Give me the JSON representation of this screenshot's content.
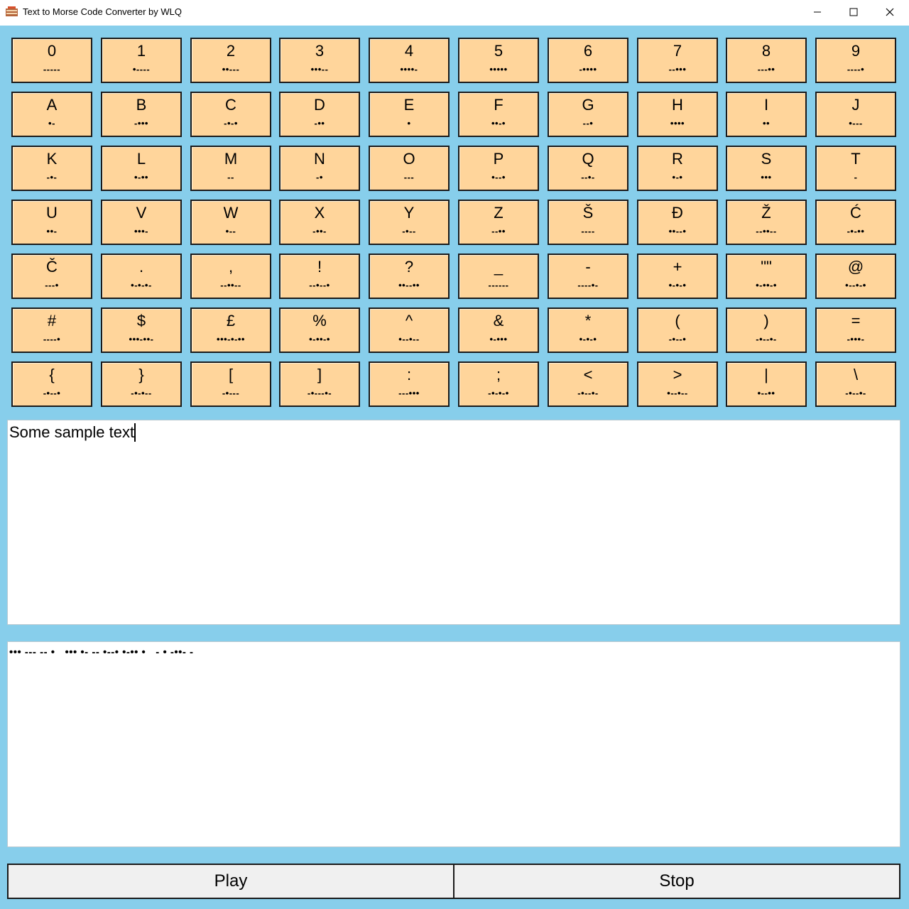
{
  "window": {
    "title": "Text to Morse Code Converter by WLQ"
  },
  "keys": [
    [
      {
        "char": "0",
        "morse": "-----"
      },
      {
        "char": "1",
        "morse": "•----"
      },
      {
        "char": "2",
        "morse": "••---"
      },
      {
        "char": "3",
        "morse": "•••--"
      },
      {
        "char": "4",
        "morse": "••••-"
      },
      {
        "char": "5",
        "morse": "•••••"
      },
      {
        "char": "6",
        "morse": "-••••"
      },
      {
        "char": "7",
        "morse": "--•••"
      },
      {
        "char": "8",
        "morse": "---••"
      },
      {
        "char": "9",
        "morse": "----•"
      }
    ],
    [
      {
        "char": "A",
        "morse": "•-"
      },
      {
        "char": "B",
        "morse": "-•••"
      },
      {
        "char": "C",
        "morse": "-•-•"
      },
      {
        "char": "D",
        "morse": "-••"
      },
      {
        "char": "E",
        "morse": "•"
      },
      {
        "char": "F",
        "morse": "••-•"
      },
      {
        "char": "G",
        "morse": "--•"
      },
      {
        "char": "H",
        "morse": "••••"
      },
      {
        "char": "I",
        "morse": "••"
      },
      {
        "char": "J",
        "morse": "•---"
      }
    ],
    [
      {
        "char": "K",
        "morse": "-•-"
      },
      {
        "char": "L",
        "morse": "•-••"
      },
      {
        "char": "M",
        "morse": "--"
      },
      {
        "char": "N",
        "morse": "-•"
      },
      {
        "char": "O",
        "morse": "---"
      },
      {
        "char": "P",
        "morse": "•--•"
      },
      {
        "char": "Q",
        "morse": "--•-"
      },
      {
        "char": "R",
        "morse": "•-•"
      },
      {
        "char": "S",
        "morse": "•••"
      },
      {
        "char": "T",
        "morse": "-"
      }
    ],
    [
      {
        "char": "U",
        "morse": "••-"
      },
      {
        "char": "V",
        "morse": "•••-"
      },
      {
        "char": "W",
        "morse": "•--"
      },
      {
        "char": "X",
        "morse": "-••-"
      },
      {
        "char": "Y",
        "morse": "-•--"
      },
      {
        "char": "Z",
        "morse": "--••"
      },
      {
        "char": "Š",
        "morse": "----"
      },
      {
        "char": "Đ",
        "morse": "••--•"
      },
      {
        "char": "Ž",
        "morse": "--••--"
      },
      {
        "char": "Ć",
        "morse": "-•-••"
      }
    ],
    [
      {
        "char": "Č",
        "morse": "---•"
      },
      {
        "char": ".",
        "morse": "•-•-•-"
      },
      {
        "char": ",",
        "morse": "--••--"
      },
      {
        "char": "!",
        "morse": "--•--•"
      },
      {
        "char": "?",
        "morse": "••--••"
      },
      {
        "char": "_",
        "morse": "------"
      },
      {
        "char": "-",
        "morse": "----•-"
      },
      {
        "char": "+",
        "morse": "•-•-•"
      },
      {
        "char": "\"\"",
        "morse": "•-••-•"
      },
      {
        "char": "@",
        "morse": "•--•-•"
      }
    ],
    [
      {
        "char": "#",
        "morse": "----•"
      },
      {
        "char": "$",
        "morse": "•••-••-"
      },
      {
        "char": "£",
        "morse": "•••-•-••"
      },
      {
        "char": "%",
        "morse": "•-••-•"
      },
      {
        "char": "^",
        "morse": "•--•--"
      },
      {
        "char": "&",
        "morse": "•-•••"
      },
      {
        "char": "*",
        "morse": "•-•-•"
      },
      {
        "char": "(",
        "morse": "-•--•"
      },
      {
        "char": ")",
        "morse": "-•--•-"
      },
      {
        "char": "=",
        "morse": "-•••-"
      }
    ],
    [
      {
        "char": "{",
        "morse": "-•--•"
      },
      {
        "char": "}",
        "morse": "-•-•--"
      },
      {
        "char": "[",
        "morse": "-•---"
      },
      {
        "char": "]",
        "morse": "-•---•-"
      },
      {
        "char": ":",
        "morse": "---•••"
      },
      {
        "char": ";",
        "morse": "-•-•-•"
      },
      {
        "char": "<",
        "morse": "-•--•-"
      },
      {
        "char": ">",
        "morse": "•--•--"
      },
      {
        "char": "|",
        "morse": "•--••"
      },
      {
        "char": "\\",
        "morse": "-•--•-"
      }
    ]
  ],
  "input_text": "Some sample text",
  "output_text": "••• --- -- •   ••• •- -- •--• •-•• •   - • -••- -",
  "buttons": {
    "play_label": "Play",
    "stop_label": "Stop"
  },
  "colors": {
    "background": "#87ceeb",
    "key_fill": "#ffd59b"
  }
}
